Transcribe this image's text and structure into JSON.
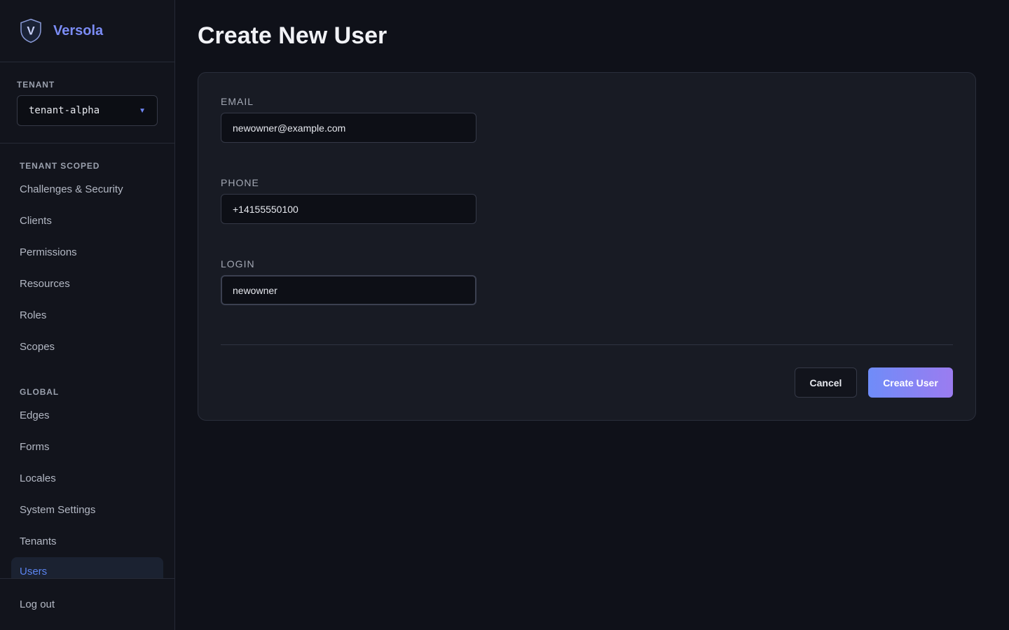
{
  "brand": {
    "name": "Versola",
    "logo_letter": "V",
    "accent_color": "#7b8cf5"
  },
  "tenant": {
    "label": "TENANT",
    "selected": "tenant-alpha"
  },
  "nav": {
    "tenant_scoped_label": "TENANT SCOPED",
    "tenant_scoped_items": [
      {
        "label": "Challenges & Security"
      },
      {
        "label": "Clients"
      },
      {
        "label": "Permissions"
      },
      {
        "label": "Resources"
      },
      {
        "label": "Roles"
      },
      {
        "label": "Scopes"
      }
    ],
    "global_label": "GLOBAL",
    "global_items": [
      {
        "label": "Edges"
      },
      {
        "label": "Forms"
      },
      {
        "label": "Locales"
      },
      {
        "label": "System Settings"
      },
      {
        "label": "Tenants"
      },
      {
        "label": "Users",
        "active": true
      }
    ],
    "logout_label": "Log out"
  },
  "page": {
    "title": "Create New User"
  },
  "form": {
    "email": {
      "label": "EMAIL",
      "value": "newowner@example.com"
    },
    "phone": {
      "label": "PHONE",
      "value": "+14155550100"
    },
    "login": {
      "label": "LOGIN",
      "value": "newowner",
      "focused": true
    },
    "cancel_label": "Cancel",
    "submit_label": "Create User"
  },
  "colors": {
    "background": "#0f1119",
    "sidebar": "#12141c",
    "card": "#181b24",
    "active_nav_text": "#5b84f0",
    "button_gradient_start": "#6f8cf8",
    "button_gradient_end": "#9b7cf0"
  }
}
